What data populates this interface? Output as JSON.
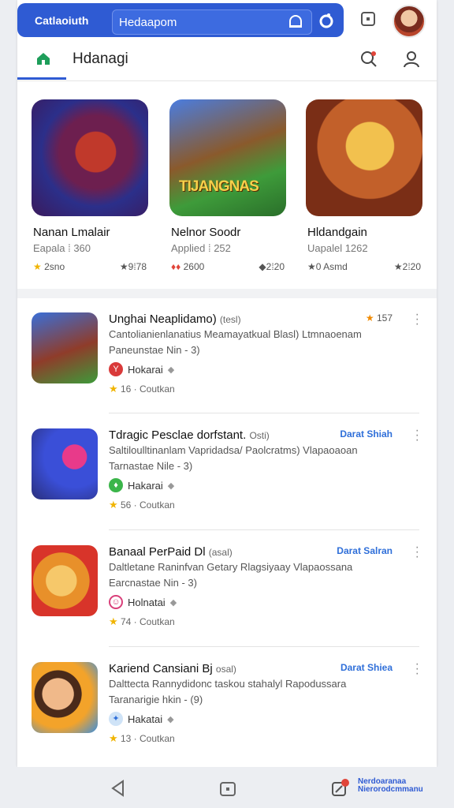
{
  "topbar": {
    "brand": "Catlaoiuth",
    "search_query": "Hedaapom"
  },
  "tabbar": {
    "title": "Hdanagi"
  },
  "featured": [
    {
      "name": "Nanan Lmalair",
      "sub": "Eapala ⁞ 360",
      "stars": "2sno",
      "downloads": "9⁞78"
    },
    {
      "name": "Nelnor Soodr",
      "sub": "Applied ⁞ 252",
      "stars": "2600",
      "downloads": "2⁞20"
    },
    {
      "name": "Hldandgain",
      "sub": "Uapalel 1262",
      "stars": "0 Asmd",
      "downloads": "2⁞20"
    }
  ],
  "featured_art_caption": "TIJANGNAS",
  "list": [
    {
      "title": "Unghai Neaplidamo)",
      "title_tail": "(tesl)",
      "desc1": "Cantolianienlanatius Meamayatkual Blasl) Ltmnaoenam",
      "desc2": "Paneunstae Nin - 3)",
      "dev": "Hokarai",
      "dev_badge": "Y",
      "rating": "16 · Coutkan",
      "right": "157",
      "right_kind": "rating"
    },
    {
      "title": "Tdragic Pesclae dorfstant.",
      "title_tail": "Osti)",
      "desc1": "Saltiloulltinanlam Vapridadsa/ Paolcratms) Vlapaoaoan",
      "desc2": "Tarnastae Nile - 3)",
      "dev": "Hakarai",
      "dev_badge": "♦",
      "rating": "56 · Coutkan",
      "right": "Darat   Shiah",
      "right_kind": "link"
    },
    {
      "title": "Banaal PerPaid Dl",
      "title_tail": "(asal)",
      "desc1": "Daltletane Raninfvan Getary Rlagsiyaay Vlapaossana",
      "desc2": "Earcnastae Nin - 3)",
      "dev": "Holnatai",
      "dev_badge": "☺",
      "rating": "74 · Coutkan",
      "right": "Darat   Salran",
      "right_kind": "link"
    },
    {
      "title": "Kariend Cansiani Bj",
      "title_tail": "osal)",
      "desc1": "Dalttecta Rannydidonc taskou stahalyl Rapodussara",
      "desc2": "Taranarigie hkin - (9)",
      "dev": "Hakatai",
      "dev_badge": "✦",
      "rating": "13 · Coutkan",
      "right": "Darat   Shiea",
      "right_kind": "link"
    }
  ],
  "navbar": {
    "label_line1": "Nerdoaranaa",
    "label_line2": "Nierorodcmmanu"
  },
  "colors": {
    "accent": "#2f5bd3",
    "star": "#f0b400",
    "link": "#2f6fd9"
  }
}
